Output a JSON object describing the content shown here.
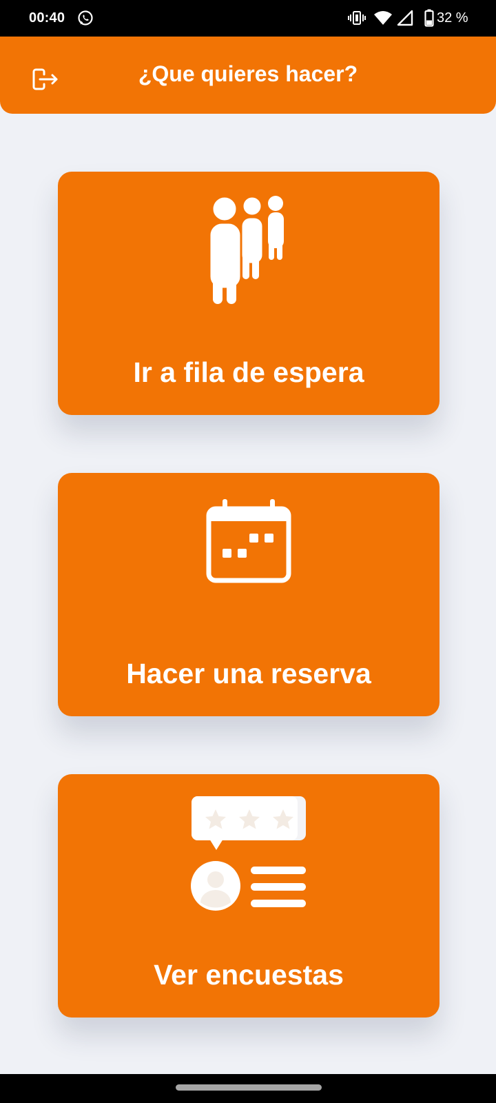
{
  "status_bar": {
    "time": "00:40",
    "battery_percent": "32 %",
    "icons": [
      "whatsapp-icon",
      "vibrate-icon",
      "wifi-icon",
      "cell-signal-icon",
      "battery-icon"
    ]
  },
  "header": {
    "title": "¿Que quieres hacer?",
    "logout_icon": "logout-icon"
  },
  "options": [
    {
      "label": "Ir a fila de espera",
      "icon": "queue-people-icon"
    },
    {
      "label": "Hacer una reserva",
      "icon": "calendar-icon"
    },
    {
      "label": "Ver encuestas",
      "icon": "survey-rating-icon"
    }
  ],
  "colors": {
    "accent": "#f27405",
    "background": "#eff1f6",
    "text_on_accent": "#ffffff"
  }
}
